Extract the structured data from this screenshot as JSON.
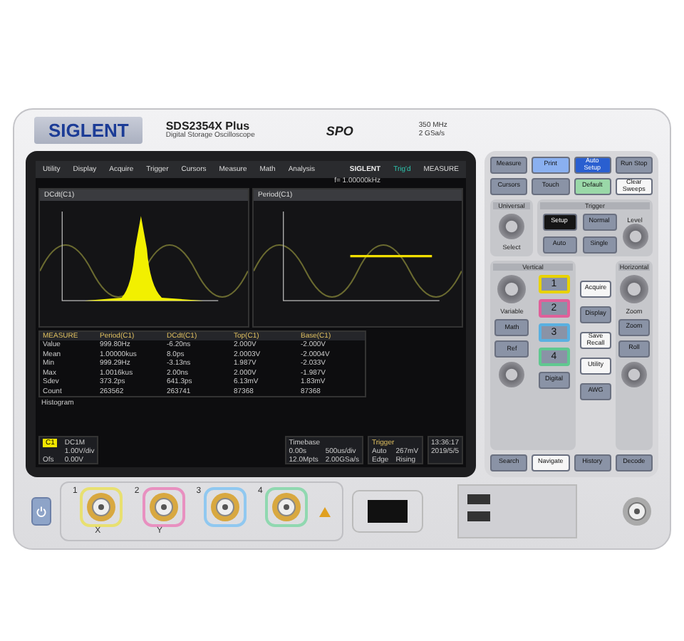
{
  "brand": "SIGLENT",
  "model": "SDS2354X Plus",
  "subtitle": "Digital Storage Oscilloscope",
  "spo": "SPO",
  "specs": [
    "350 MHz",
    "2 GSa/s"
  ],
  "screen": {
    "menu": [
      "Utility",
      "Display",
      "Acquire",
      "Trigger",
      "Cursors",
      "Measure",
      "Math",
      "Analysis"
    ],
    "logo": "SIGLENT",
    "trig_state": "Trig'd",
    "freq": "f= 1.00000kHz",
    "measure_label": "MEASURE",
    "plots": [
      {
        "title": "DCdt(C1)",
        "kind": "histogram"
      },
      {
        "title": "Period(C1)",
        "kind": "trend"
      }
    ],
    "table": {
      "corner": "MEASURE",
      "columns": [
        "Period(C1)",
        "DCdt(C1)",
        "Top(C1)",
        "Base(C1)"
      ],
      "rows": [
        {
          "label": "Value",
          "cells": [
            "999.80Hz",
            "-6.20ns",
            "2.000V",
            "-2.000V"
          ]
        },
        {
          "label": "Mean",
          "cells": [
            "1.00000kus",
            "8.0ps",
            "2.0003V",
            "-2.0004V"
          ]
        },
        {
          "label": "Min",
          "cells": [
            "999.29Hz",
            "-3.13ns",
            "1.987V",
            "-2.033V"
          ]
        },
        {
          "label": "Max",
          "cells": [
            "1.0016kus",
            "2.00ns",
            "2.000V",
            "-1.987V"
          ]
        },
        {
          "label": "Sdev",
          "cells": [
            "373.2ps",
            "641.3ps",
            "6.13mV",
            "1.83mV"
          ]
        },
        {
          "label": "Count",
          "cells": [
            "263562",
            "263741",
            "87368",
            "87368"
          ]
        }
      ]
    },
    "histogram_label": "Histogram",
    "channel": {
      "name": "C1",
      "coupling": "DC1M",
      "scale": "1.00V/div",
      "offset_label": "Ofs",
      "offset": "0.00V",
      "color": "#f2e600"
    },
    "timebase": {
      "title": "Timebase",
      "cells": [
        "0.00s",
        "500us/div",
        "12.0Mpts",
        "2.00GSa/s"
      ]
    },
    "trigger": {
      "title": "Trigger",
      "cells": [
        "Auto",
        "267mV",
        "Edge",
        "Rising"
      ]
    },
    "clock": [
      "13:36:17",
      "2019/5/5"
    ]
  },
  "panel": {
    "top": [
      {
        "label": "Measure",
        "kind": "plain"
      },
      {
        "label": "Print",
        "kind": "light"
      },
      {
        "label": "Auto Setup",
        "kind": "lit"
      },
      {
        "label": "Run Stop",
        "kind": "plain"
      },
      {
        "label": "Cursors",
        "kind": "plain"
      },
      {
        "label": "Touch",
        "kind": "plain"
      },
      {
        "label": "Default",
        "kind": "green"
      },
      {
        "label": "Clear Sweeps",
        "kind": "white"
      }
    ],
    "universal": {
      "title": "Universal",
      "knob": "Select"
    },
    "trigger": {
      "title": "Trigger",
      "buttons": [
        {
          "label": "Setup",
          "kind": "dark"
        },
        {
          "label": "Normal",
          "kind": "plain"
        },
        {
          "label": "Auto",
          "kind": "plain"
        },
        {
          "label": "Single",
          "kind": "plain"
        }
      ],
      "knob": "Level"
    },
    "vertical": {
      "title": "Vertical",
      "knob": "Variable",
      "buttons": [
        "Math",
        "Ref"
      ],
      "channels": [
        {
          "label": "1",
          "color": "#e8d200"
        },
        {
          "label": "2",
          "color": "#e0609a"
        },
        {
          "label": "3",
          "color": "#5ab0e0"
        },
        {
          "label": "4",
          "color": "#60c890"
        }
      ],
      "digital": "Digital"
    },
    "middle": [
      {
        "label": "Acquire",
        "kind": "white"
      },
      {
        "label": "Display",
        "kind": "plain"
      },
      {
        "label": "Save Recall",
        "kind": "white"
      },
      {
        "label": "Utility",
        "kind": "white"
      },
      {
        "label": "AWG",
        "kind": "plain"
      }
    ],
    "horizontal": {
      "title": "Horizontal",
      "knob": "Zoom",
      "buttons": [
        "Zoom",
        "Roll"
      ]
    },
    "bottom": [
      {
        "label": "Search",
        "kind": "plain"
      },
      {
        "label": "Navigate",
        "kind": "white"
      },
      {
        "label": "History",
        "kind": "plain"
      },
      {
        "label": "Decode",
        "kind": "plain"
      }
    ]
  },
  "front": {
    "inputs": [
      {
        "label": "1",
        "axis": "X",
        "color": "#e8e070"
      },
      {
        "label": "2",
        "axis": "Y",
        "color": "#e890c0"
      },
      {
        "label": "3",
        "color": "#90c8f0"
      },
      {
        "label": "4",
        "color": "#90d8b0"
      }
    ]
  }
}
